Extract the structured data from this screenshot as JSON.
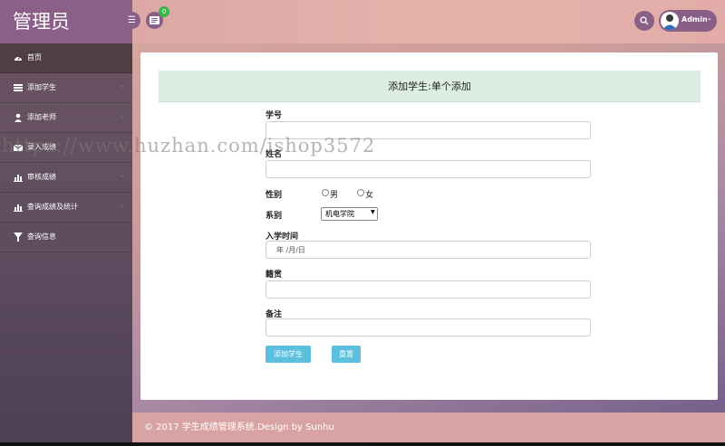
{
  "header": {
    "brand": "管理员",
    "message_badge": "0",
    "user_name": "Admin",
    "icons": [
      "menu-toggle-icon",
      "message-icon",
      "search-icon",
      "user-avatar",
      "chevron-down-icon"
    ]
  },
  "sidebar": {
    "items": [
      {
        "label": "首页",
        "icon": "dashboard-icon",
        "active": true
      },
      {
        "label": "添加学生",
        "icon": "list-icon"
      },
      {
        "label": "添加老师",
        "icon": "user-icon"
      },
      {
        "label": "录入成绩",
        "icon": "envelope-icon"
      },
      {
        "label": "审核成绩",
        "icon": "bar-chart-icon"
      },
      {
        "label": "查询成绩及统计",
        "icon": "bar-chart-icon"
      },
      {
        "label": "查询信息",
        "icon": "filter-icon"
      }
    ]
  },
  "form": {
    "title": "添加学生:单个添加",
    "student_id_label": "学号",
    "name_label": "姓名",
    "gender_label": "性别",
    "gender_options": [
      "男",
      "女"
    ],
    "department_label": "系别",
    "department_value": "机电学院",
    "enroll_label": "入学时间",
    "enroll_placeholder": "年 /月/日",
    "native_label": "籍贯",
    "remark_label": "备注",
    "submit_label": "添加学生",
    "reset_label": "重置"
  },
  "footer": {
    "text": "© 2017 学生成绩管理系统.Design by Sunhu"
  },
  "watermark": "https://www.huzhan.com/ishop3572",
  "colors": {
    "brand_bg": "#8c5f88",
    "button_bg": "#5bc0de",
    "card_header_bg": "#dcede4",
    "badge_bg": "#3cb54a"
  }
}
